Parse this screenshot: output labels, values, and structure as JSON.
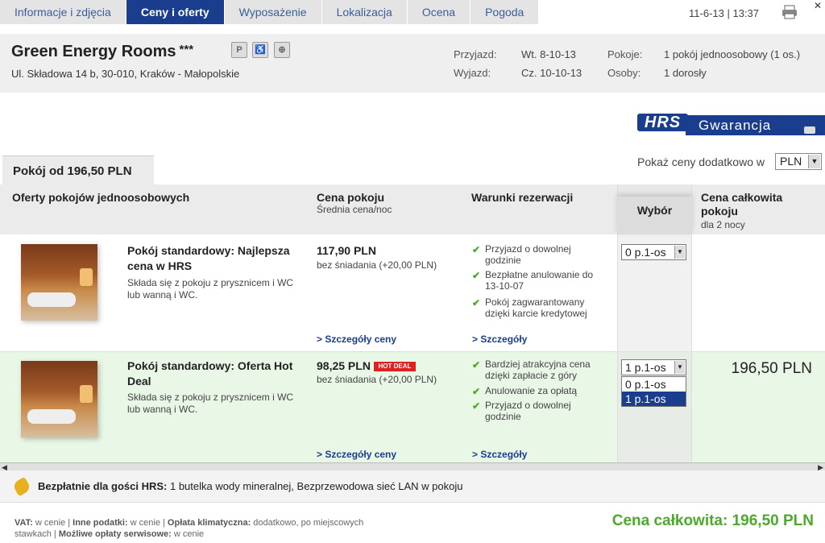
{
  "tabs": [
    "Informacje i zdjęcia",
    "Ceny i oferty",
    "Wyposażenie",
    "Lokalizacja",
    "Ocena",
    "Pogoda"
  ],
  "active_tab": "Ceny i oferty",
  "timestamp": "11-6-13 | 13:37",
  "hotel": {
    "name": "Green Energy Rooms",
    "stars": "***",
    "amenities": [
      "P",
      "parking-icon",
      "wifi-icon"
    ],
    "address": "Ul. Składowa 14 b, 30-010, Kraków - Małopolskie"
  },
  "booking": {
    "arrival_label": "Przyjazd:",
    "arrival_value": "Wt. 8-10-13",
    "departure_label": "Wyjazd:",
    "departure_value": "Cz. 10-10-13",
    "rooms_label": "Pokoje:",
    "rooms_value": "1 pokój jednoosobowy (1 os.)",
    "persons_label": "Osoby:",
    "persons_value": "1 dorosły"
  },
  "guarantee": {
    "logo": "HRS",
    "label": "Gwarancja"
  },
  "room_tab": "Pokój od 196,50 PLN",
  "currency": {
    "label": "Pokaż ceny dodatkowo w",
    "value": "PLN"
  },
  "columns": {
    "offers": "Oferty pokojów jednoosobowych",
    "price": "Cena pokoju",
    "price_sub": "Średnia cena/noc",
    "conditions": "Warunki rezerwacji",
    "select": "Wybór",
    "total": "Cena całkowita pokoju",
    "total_sub": "dla 2 nocy"
  },
  "rooms": [
    {
      "name": "Pokój standardowy: Najlepsza cena w HRS",
      "desc": "Składa się z pokoju z prysznicem i WC lub wanną i WC.",
      "price": "117,90 PLN",
      "price_note": "bez śniadania (+20,00 PLN)",
      "conditions": [
        "Przyjazd o dowolnej godzinie",
        "Bezpłatne anulowanie do 13-10-07",
        "Pokój zagwarantowany dzięki karcie kredytowej"
      ],
      "price_details": "> Szczegóły ceny",
      "details": "> Szczegóły",
      "selected": "0 p.1-os",
      "total": ""
    },
    {
      "name": "Pokój standardowy: Oferta Hot Deal",
      "desc": "Składa się z pokoju z prysznicem i WC lub wanną i WC.",
      "price": "98,25 PLN",
      "badge": "HOT DEAL",
      "price_note": "bez śniadania (+20,00 PLN)",
      "conditions": [
        "Bardziej atrakcyjna cena dzięki zapłacie z góry",
        "Anulowanie za opłatą",
        "Przyjazd o dowolnej godzinie"
      ],
      "price_details": "> Szczegóły ceny",
      "details": "> Szczegóły",
      "selected": "1 p.1-os",
      "options": [
        "0 p.1-os",
        "1 p.1-os"
      ],
      "total": "196,50 PLN"
    }
  ],
  "free": {
    "label": "Bezpłatnie dla gości HRS:",
    "text": " 1 butelka wody mineralnej, Bezprzewodowa sieć LAN w pokoju"
  },
  "vat": {
    "vat_label": "VAT:",
    "vat_value": " w cenie | ",
    "tax_label": "Inne podatki:",
    "tax_value": " w cenie | ",
    "climate_label": "Opłata klimatyczna:",
    "climate_value": " dodatkowo, po miejscowych stawkach | ",
    "service_label": "Możliwe opłaty serwisowe:",
    "service_value": " w cenie"
  },
  "grand_total": "Cena całkowita: 196,50 PLN"
}
